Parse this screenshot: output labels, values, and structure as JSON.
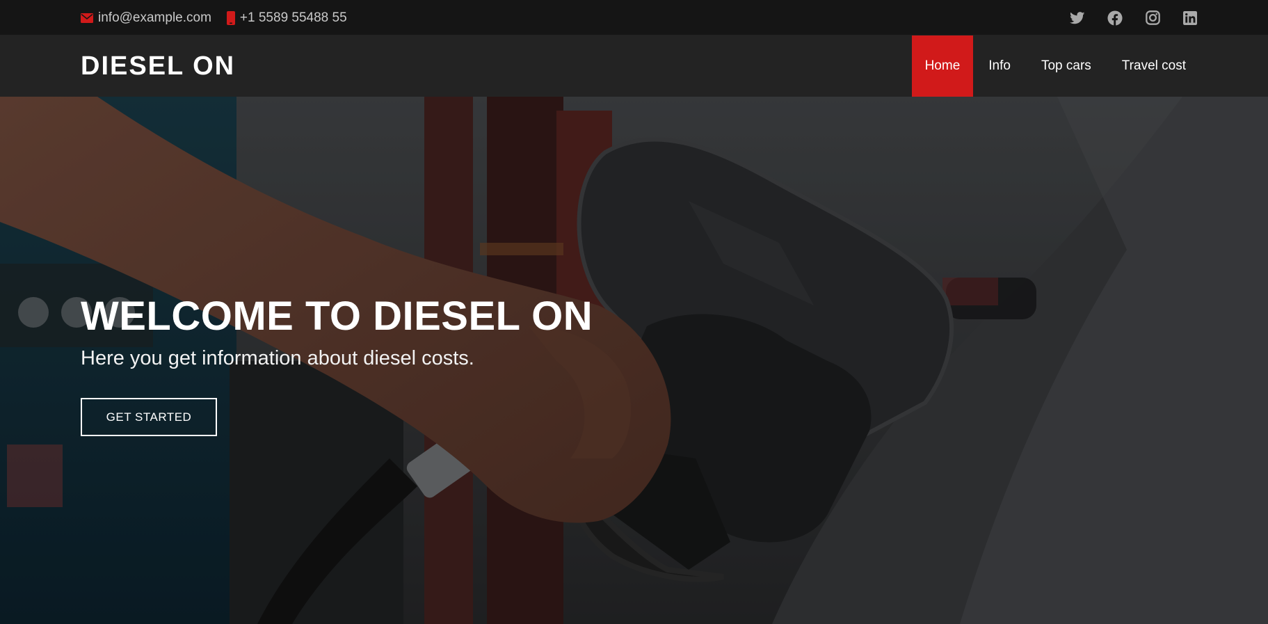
{
  "topbar": {
    "email": "info@example.com",
    "phone": "+1 5589 55488 55",
    "icons": [
      "envelope-icon",
      "phone-icon",
      "twitter-icon",
      "facebook-icon",
      "instagram-icon",
      "linkedin-icon"
    ]
  },
  "header": {
    "logo": "DIESEL ON",
    "nav": [
      {
        "label": "Home",
        "active": true
      },
      {
        "label": "Info",
        "active": false
      },
      {
        "label": "Top cars",
        "active": false
      },
      {
        "label": "Travel cost",
        "active": false
      }
    ]
  },
  "hero": {
    "title": "WELCOME TO DIESEL ON",
    "subtitle": "Here you get information about diesel costs.",
    "cta": "GET STARTED"
  },
  "colors": {
    "accent": "#d11a1a",
    "topbar": "#151515",
    "header": "#232323"
  }
}
